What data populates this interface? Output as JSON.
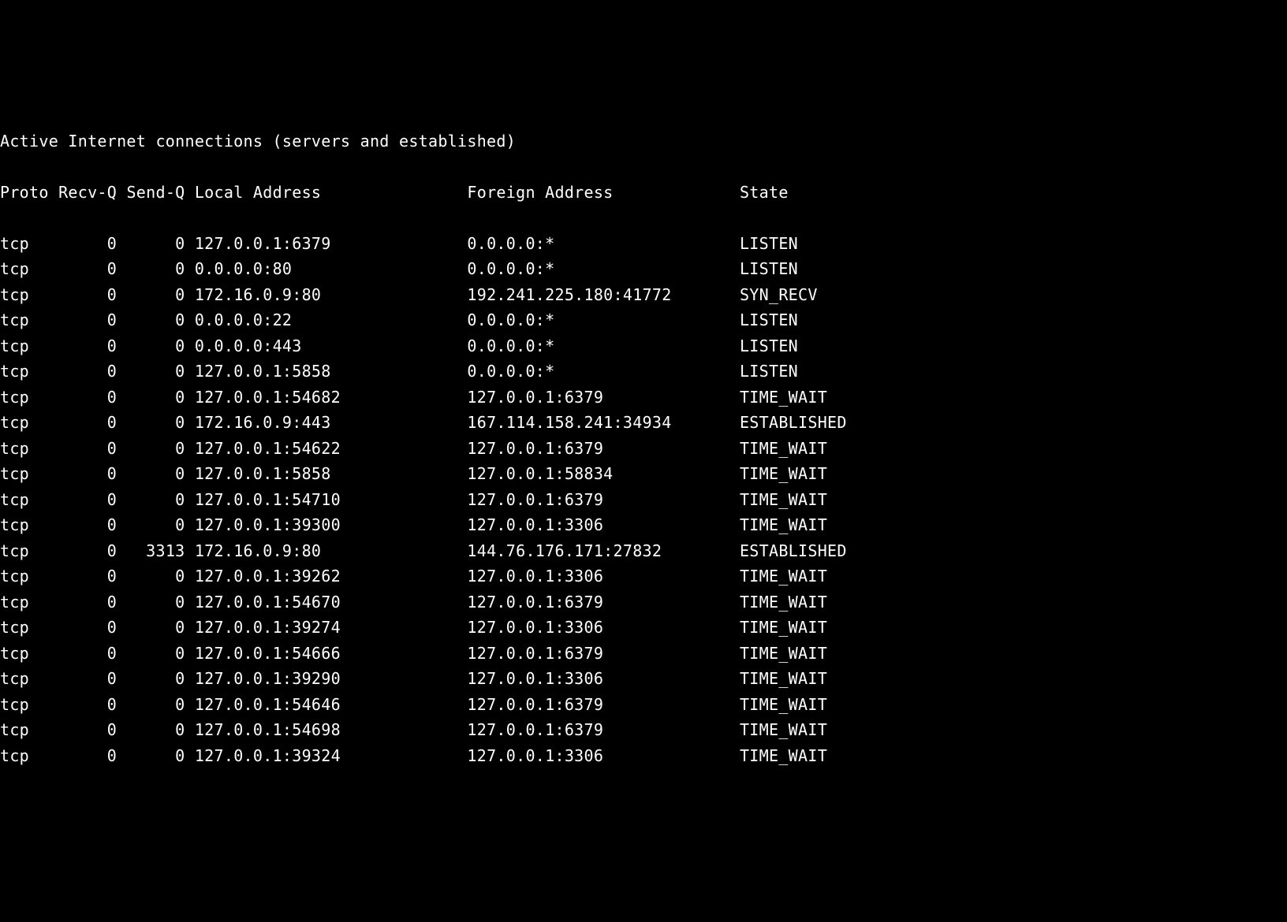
{
  "title": "Active Internet connections (servers and established)",
  "columns": {
    "proto": "Proto",
    "recvq": "Recv-Q",
    "sendq": "Send-Q",
    "local": "Local Address",
    "foreign": "Foreign Address",
    "state": "State"
  },
  "rows": [
    {
      "proto": "tcp",
      "recvq": "0",
      "sendq": "0",
      "local": "127.0.0.1:6379",
      "foreign": "0.0.0.0:*",
      "state": "LISTEN"
    },
    {
      "proto": "tcp",
      "recvq": "0",
      "sendq": "0",
      "local": "0.0.0.0:80",
      "foreign": "0.0.0.0:*",
      "state": "LISTEN"
    },
    {
      "proto": "tcp",
      "recvq": "0",
      "sendq": "0",
      "local": "172.16.0.9:80",
      "foreign": "192.241.225.180:41772",
      "state": "SYN_RECV"
    },
    {
      "proto": "tcp",
      "recvq": "0",
      "sendq": "0",
      "local": "0.0.0.0:22",
      "foreign": "0.0.0.0:*",
      "state": "LISTEN"
    },
    {
      "proto": "tcp",
      "recvq": "0",
      "sendq": "0",
      "local": "0.0.0.0:443",
      "foreign": "0.0.0.0:*",
      "state": "LISTEN"
    },
    {
      "proto": "tcp",
      "recvq": "0",
      "sendq": "0",
      "local": "127.0.0.1:5858",
      "foreign": "0.0.0.0:*",
      "state": "LISTEN"
    },
    {
      "proto": "tcp",
      "recvq": "0",
      "sendq": "0",
      "local": "127.0.0.1:54682",
      "foreign": "127.0.0.1:6379",
      "state": "TIME_WAIT"
    },
    {
      "proto": "tcp",
      "recvq": "0",
      "sendq": "0",
      "local": "172.16.0.9:443",
      "foreign": "167.114.158.241:34934",
      "state": "ESTABLISHED"
    },
    {
      "proto": "tcp",
      "recvq": "0",
      "sendq": "0",
      "local": "127.0.0.1:54622",
      "foreign": "127.0.0.1:6379",
      "state": "TIME_WAIT"
    },
    {
      "proto": "tcp",
      "recvq": "0",
      "sendq": "0",
      "local": "127.0.0.1:5858",
      "foreign": "127.0.0.1:58834",
      "state": "TIME_WAIT"
    },
    {
      "proto": "tcp",
      "recvq": "0",
      "sendq": "0",
      "local": "127.0.0.1:54710",
      "foreign": "127.0.0.1:6379",
      "state": "TIME_WAIT"
    },
    {
      "proto": "tcp",
      "recvq": "0",
      "sendq": "0",
      "local": "127.0.0.1:39300",
      "foreign": "127.0.0.1:3306",
      "state": "TIME_WAIT"
    },
    {
      "proto": "tcp",
      "recvq": "0",
      "sendq": "3313",
      "local": "172.16.0.9:80",
      "foreign": "144.76.176.171:27832",
      "state": "ESTABLISHED"
    },
    {
      "proto": "tcp",
      "recvq": "0",
      "sendq": "0",
      "local": "127.0.0.1:39262",
      "foreign": "127.0.0.1:3306",
      "state": "TIME_WAIT"
    },
    {
      "proto": "tcp",
      "recvq": "0",
      "sendq": "0",
      "local": "127.0.0.1:54670",
      "foreign": "127.0.0.1:6379",
      "state": "TIME_WAIT"
    },
    {
      "proto": "tcp",
      "recvq": "0",
      "sendq": "0",
      "local": "127.0.0.1:39274",
      "foreign": "127.0.0.1:3306",
      "state": "TIME_WAIT"
    },
    {
      "proto": "tcp",
      "recvq": "0",
      "sendq": "0",
      "local": "127.0.0.1:54666",
      "foreign": "127.0.0.1:6379",
      "state": "TIME_WAIT"
    },
    {
      "proto": "tcp",
      "recvq": "0",
      "sendq": "0",
      "local": "127.0.0.1:39290",
      "foreign": "127.0.0.1:3306",
      "state": "TIME_WAIT"
    },
    {
      "proto": "tcp",
      "recvq": "0",
      "sendq": "0",
      "local": "127.0.0.1:54646",
      "foreign": "127.0.0.1:6379",
      "state": "TIME_WAIT"
    },
    {
      "proto": "tcp",
      "recvq": "0",
      "sendq": "0",
      "local": "127.0.0.1:54698",
      "foreign": "127.0.0.1:6379",
      "state": "TIME_WAIT"
    },
    {
      "proto": "tcp",
      "recvq": "0",
      "sendq": "0",
      "local": "127.0.0.1:39324",
      "foreign": "127.0.0.1:3306",
      "state": "TIME_WAIT"
    }
  ]
}
